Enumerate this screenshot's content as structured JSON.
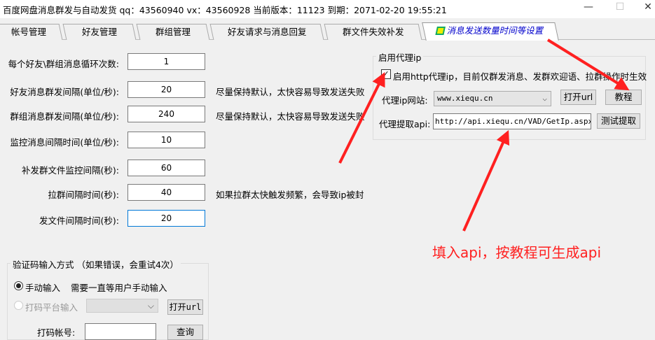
{
  "window": {
    "title": "百度网盘消息群发与自动发货   qq：43560940 vx：43560928  当前版本：11123  到期：2071-02-20 19:55:21",
    "minimize": "—",
    "maximize": "☐",
    "close": "✕"
  },
  "tabs": [
    {
      "label": "帐号管理"
    },
    {
      "label": "好友管理"
    },
    {
      "label": "群组管理"
    },
    {
      "label": "好友请求与消息回复"
    },
    {
      "label": "群文件失效补发"
    },
    {
      "label": "消息发送数量时间等设置"
    }
  ],
  "settings": [
    {
      "label": "每个好友\\群组消息循环次数:",
      "value": "1",
      "hint": ""
    },
    {
      "label": "好友消息群发间隔(单位/秒):",
      "value": "20",
      "hint": "尽量保持默认，太快容易导致发送失败"
    },
    {
      "label": "群组消息群发间隔(单位/秒):",
      "value": "240",
      "hint": "尽量保持默认，太快容易导致发送失败"
    },
    {
      "label": "监控消息间隔时间(单位/秒):",
      "value": "10",
      "hint": ""
    },
    {
      "label": "补发群文件监控间隔(秒):",
      "value": "60",
      "hint": ""
    },
    {
      "label": "拉群间隔时间(秒):",
      "value": "40",
      "hint": "如果拉群太快触发频繁，会导致ip被封"
    },
    {
      "label": "发文件间隔时间(秒):",
      "value": "20",
      "hint": ""
    }
  ],
  "proxy": {
    "group_label": "启用代理ip",
    "enable_label": "启用http代理ip，目前仅群发消息、发群欢迎语、拉群操作时生效",
    "enabled": true,
    "site_label": "代理ip网站:",
    "site_value": "www.xiequ.cn",
    "open_url": "打开url",
    "tutorial": "教程",
    "api_label": "代理提取api:",
    "api_value": "http://api.xiequ.cn/VAD/GetIp.aspx?ac",
    "test": "测试提取"
  },
  "captcha": {
    "group_label": "验证码输入方式  （如果错误，会重试4次）",
    "manual_label": "手动输入",
    "manual_hint": "需要一直等用户手动输入",
    "platform_label": "打码平台输入",
    "open_url": "打开url",
    "account_label": "打码帐号:",
    "query": "查询"
  },
  "annotation": "填入api，按教程可生成api",
  "colors": {
    "annotation": "#ff2020",
    "active_tab": "#0000cc"
  }
}
